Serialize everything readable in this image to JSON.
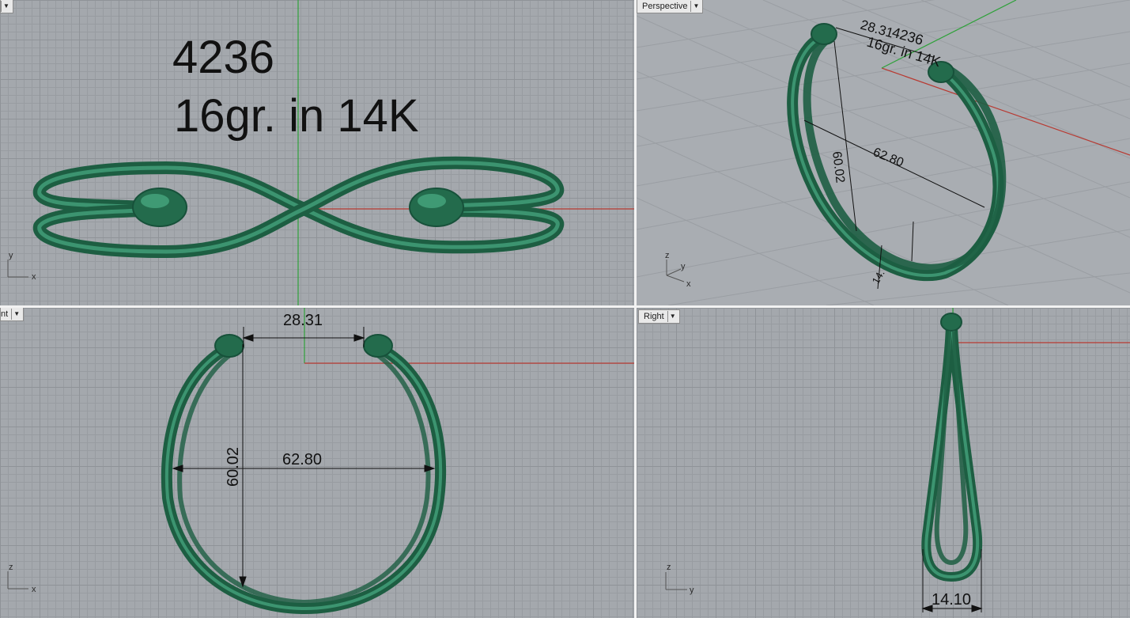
{
  "viewports": {
    "top": {
      "label": "",
      "title_line1": "4236",
      "title_line2": "16gr. in 14K",
      "axis": {
        "vertical": "y",
        "horizontal": "x"
      }
    },
    "perspective": {
      "label": "Perspective",
      "dim_gap": "28.31",
      "dim_height": "60.02",
      "dim_width": "62.80",
      "dim_depth": "14.",
      "text_line1": "4236",
      "text_line2": "16gr. in 14K",
      "axis": {
        "z": "z",
        "y": "y",
        "x": "x"
      }
    },
    "front": {
      "label": "nt",
      "dim_gap": "28.31",
      "dim_height": "60.02",
      "dim_width": "62.80",
      "axis": {
        "vertical": "z",
        "horizontal": "x"
      }
    },
    "right": {
      "label": "Right",
      "dim_depth": "14.10",
      "axis": {
        "vertical": "z",
        "horizontal": "y"
      }
    }
  },
  "colors": {
    "metal": "#1f6b4c",
    "metal_light": "#3f9a74",
    "x_axis": "#b83a32",
    "y_axis": "#2f9a38",
    "grid_bg": "#a4a8ad",
    "divider": "#f2f2f2"
  }
}
